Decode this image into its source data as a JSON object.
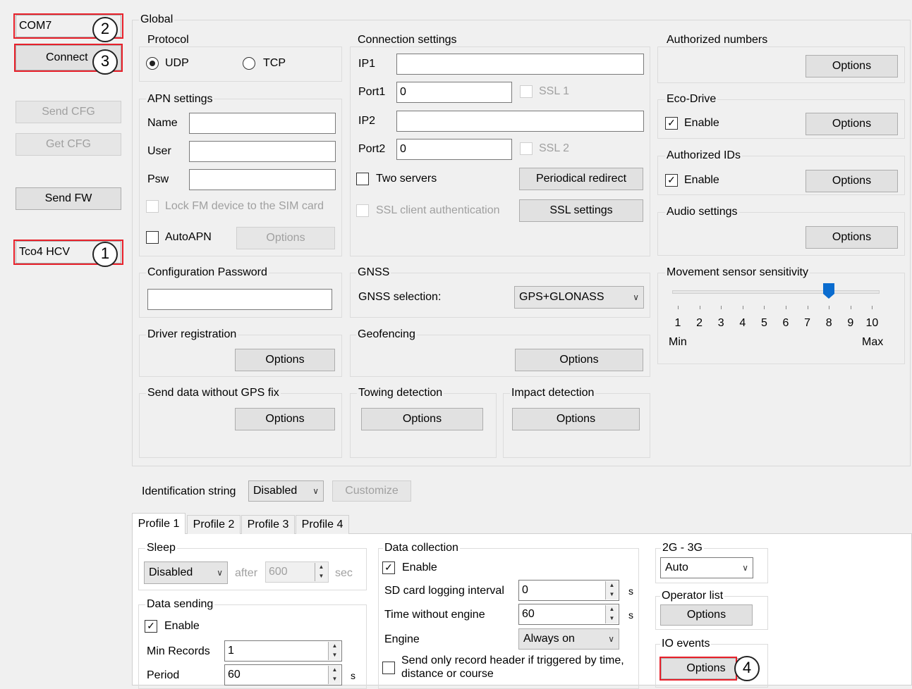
{
  "left": {
    "port_value": "COM7",
    "connect_label": "Connect",
    "send_cfg_label": "Send CFG",
    "get_cfg_label": "Get CFG",
    "send_fw_label": "Send FW",
    "device_value": "Tco4 HCV"
  },
  "markers": {
    "m1": "1",
    "m2": "2",
    "m3": "3",
    "m4": "4"
  },
  "global": {
    "title": "Global",
    "protocol": {
      "title": "Protocol",
      "udp": "UDP",
      "tcp": "TCP",
      "selected": "UDP"
    },
    "apn": {
      "title": "APN settings",
      "name_label": "Name",
      "user_label": "User",
      "psw_label": "Psw",
      "lock_label": "Lock FM device to the SIM card",
      "autoapn_label": "AutoAPN",
      "options_label": "Options"
    },
    "connection": {
      "title": "Connection settings",
      "ip1_label": "IP1",
      "ip1_value": "",
      "port1_label": "Port1",
      "port1_value": "0",
      "ssl1_label": "SSL 1",
      "ip2_label": "IP2",
      "ip2_value": "",
      "port2_label": "Port2",
      "port2_value": "0",
      "ssl2_label": "SSL 2",
      "two_servers_label": "Two servers",
      "periodical_label": "Periodical redirect",
      "ssl_client_label": "SSL client authentication",
      "ssl_settings_label": "SSL settings"
    },
    "authorized_numbers": {
      "title": "Authorized numbers",
      "options_label": "Options"
    },
    "eco_drive": {
      "title": "Eco-Drive",
      "enable_label": "Enable",
      "options_label": "Options"
    },
    "authorized_ids": {
      "title": "Authorized IDs",
      "enable_label": "Enable",
      "options_label": "Options"
    },
    "audio": {
      "title": "Audio settings",
      "options_label": "Options"
    },
    "config_password": {
      "title": "Configuration Password",
      "value": ""
    },
    "gnss": {
      "title": "GNSS",
      "selection_label": "GNSS selection:",
      "selection_value": "GPS+GLONASS"
    },
    "movement": {
      "title": "Movement sensor sensitivity",
      "ticks": [
        "1",
        "2",
        "3",
        "4",
        "5",
        "6",
        "7",
        "8",
        "9",
        "10"
      ],
      "min_label": "Min",
      "max_label": "Max",
      "value": 8,
      "min": 1,
      "max": 10
    },
    "driver_registration": {
      "title": "Driver registration",
      "options_label": "Options"
    },
    "geofencing": {
      "title": "Geofencing",
      "options_label": "Options"
    },
    "send_no_gps": {
      "title": "Send data without GPS fix",
      "options_label": "Options"
    },
    "towing": {
      "title": "Towing detection",
      "options_label": "Options"
    },
    "impact": {
      "title": "Impact detection",
      "options_label": "Options"
    }
  },
  "identification": {
    "label": "Identification string",
    "value": "Disabled",
    "customize_label": "Customize"
  },
  "profiles": {
    "tabs": [
      "Profile 1",
      "Profile 2",
      "Profile 3",
      "Profile 4"
    ],
    "active": "Profile 1",
    "sleep": {
      "title": "Sleep",
      "mode": "Disabled",
      "after_label": "after",
      "after_value": "600",
      "unit": "sec"
    },
    "data_sending": {
      "title": "Data sending",
      "enable_label": "Enable",
      "min_records_label": "Min Records",
      "min_records_value": "1",
      "period_label": "Period",
      "period_value": "60",
      "period_unit": "s"
    },
    "data_collection": {
      "title": "Data collection",
      "enable_label": "Enable",
      "sd_label": "SD card logging interval",
      "sd_value": "0",
      "sd_unit": "s",
      "twe_label": "Time without engine",
      "twe_value": "60",
      "twe_unit": "s",
      "engine_label": "Engine",
      "engine_value": "Always on",
      "header_label_1": "Send only record header if triggered by time,",
      "header_label_2": "distance or course"
    },
    "network": {
      "title": "2G - 3G",
      "value": "Auto"
    },
    "operator_list": {
      "title": "Operator list",
      "options_label": "Options"
    },
    "io_events": {
      "title": "IO events",
      "options_label": "Options"
    }
  }
}
